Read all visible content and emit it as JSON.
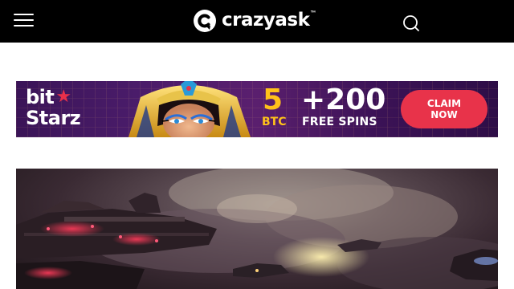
{
  "header": {
    "logo_text": "crazyask",
    "logo_tm": "™",
    "menu_icon": "hamburger-menu-icon",
    "search_icon": "search-icon",
    "background": "#000000"
  },
  "banner": {
    "brand_line1": "bit",
    "brand_star": "★",
    "brand_line2": "Starz",
    "offer_amount": "5",
    "offer_unit": "BTC",
    "offer_plus": "+200",
    "offer_spins": "FREE SPINS",
    "cta_line1": "CLAIM",
    "cta_line2": "NOW",
    "accent_color": "#e8334a",
    "gold_color": "#ffc21a"
  },
  "hero": {
    "image_kind": "sci-fi spaceships in clouds illustration"
  }
}
